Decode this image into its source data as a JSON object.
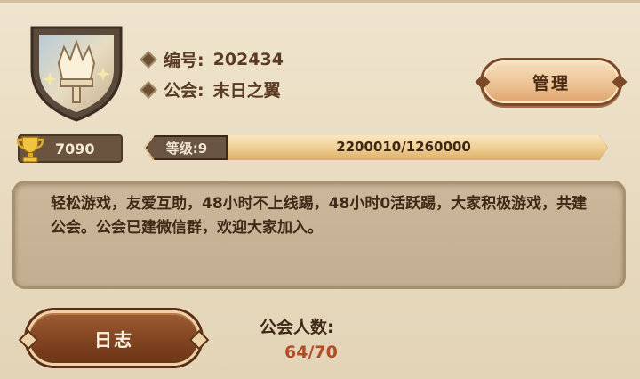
{
  "guild": {
    "id_label": "编号:",
    "id_value": "202434",
    "name_label": "公会:",
    "name_value": "末日之翼",
    "emblem_icon": "crown-shield-icon"
  },
  "actions": {
    "manage_label": "管理",
    "log_label": "日志"
  },
  "trophy": {
    "icon": "trophy-icon",
    "value": "7090"
  },
  "level": {
    "label": "等级:9",
    "progress_text": "2200010/1260000",
    "progress_fraction": 1.0
  },
  "description": "轻松游戏，友爱互助，48小时不上线踢，48小时0活跃踢，大家积极游戏，共建公会。公会已建微信群，欢迎大家加入。",
  "members": {
    "label": "公会人数:",
    "value": "64/70"
  },
  "colors": {
    "accent_text": "#b04d26",
    "primary_text": "#3f2a18",
    "button_dark": "#814421",
    "button_light": "#ecc394"
  }
}
